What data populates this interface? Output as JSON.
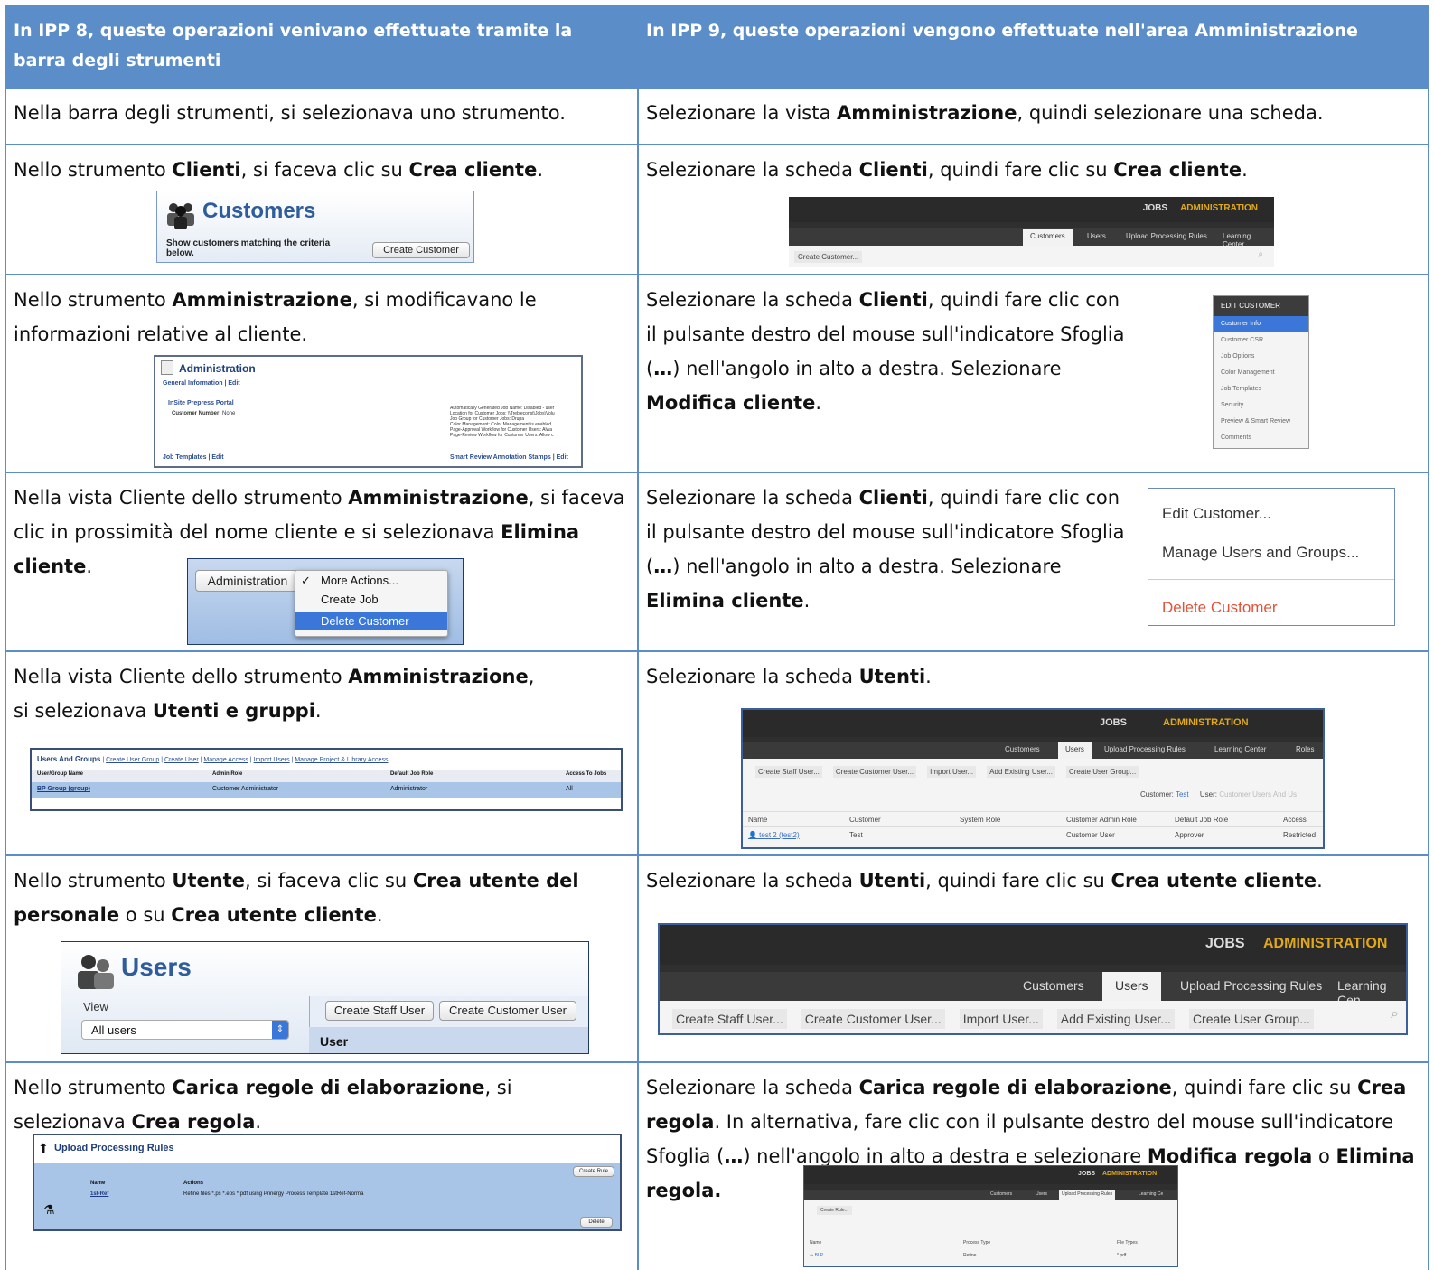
{
  "header": {
    "left": "In IPP 8, queste operazioni venivano effettuate tramite la barra degli strumenti",
    "right": "In IPP 9, queste operazioni vengono effettuate nell'area Amministrazione"
  },
  "rows": [
    {
      "left": [
        "Nella barra degli strumenti, si selezionava uno strumento."
      ],
      "right": [
        "Selezionare la vista ",
        {
          "b": "Amministrazione"
        },
        ", quindi selezionare una scheda."
      ]
    },
    {
      "left": [
        "Nello strumento ",
        {
          "b": "Clienti"
        },
        ", si faceva clic su ",
        {
          "b": "Crea cliente"
        },
        "."
      ],
      "right": [
        "Selezionare la scheda ",
        {
          "b": "Clienti"
        },
        ", quindi fare clic su ",
        {
          "b": "Crea cliente"
        },
        "."
      ]
    },
    {
      "left": [
        "Nello strumento ",
        {
          "b": "Amministrazione"
        },
        ", si modificavano le informazioni relative al cliente."
      ],
      "right": [
        "Selezionare la scheda ",
        {
          "b": "Clienti"
        },
        ", quindi fare clic con il pulsante destro del mouse sull'indicatore Sfoglia (",
        {
          "b": "…"
        },
        ") nell'angolo in alto a destra. Selezionare ",
        {
          "b": "Modifica cliente"
        },
        "."
      ]
    },
    {
      "left": [
        "Nella vista Cliente dello strumento ",
        {
          "b": "Amministrazione"
        },
        ", si faceva clic in prossimità del nome cliente e si selezionava ",
        {
          "b": "Elimina cliente"
        },
        "."
      ],
      "right": [
        "Selezionare la scheda ",
        {
          "b": "Clienti"
        },
        ", quindi fare clic con il pulsante destro del mouse sull'indicatore Sfoglia (",
        {
          "b": "…"
        },
        ") nell'angolo in alto a destra. Selezionare ",
        {
          "b": "Elimina cliente"
        },
        "."
      ]
    },
    {
      "left": [
        "Nella vista Cliente dello strumento ",
        {
          "b": "Amministrazione"
        },
        ",\nsi selezionava ",
        {
          "b": "Utenti e gruppi"
        },
        "."
      ],
      "right": [
        "Selezionare la scheda ",
        {
          "b": "Utenti"
        },
        "."
      ]
    },
    {
      "left": [
        "Nello strumento ",
        {
          "b": "Utente"
        },
        ", si faceva clic su ",
        {
          "b": "Crea utente del personale"
        },
        " o su ",
        {
          "b": "Crea utente cliente"
        },
        "."
      ],
      "right": [
        "Selezionare la scheda ",
        {
          "b": "Utenti"
        },
        ", quindi fare clic su ",
        {
          "b": "Crea utente cliente"
        },
        "."
      ]
    },
    {
      "left": [
        "Nello strumento ",
        {
          "b": "Carica regole di elaborazione"
        },
        ", si selezionava ",
        {
          "b": "Crea regola"
        },
        "."
      ],
      "right": [
        "Selezionare la scheda ",
        {
          "b": "Carica regole di elaborazione"
        },
        ", quindi fare clic su ",
        {
          "b": "Crea regola"
        },
        ". In alternativa, fare clic con il pulsante destro del mouse sull'indicatore Sfoglia (",
        {
          "b": "…"
        },
        ") nell'angolo in alto a destra e selezionare ",
        {
          "b": "Modifica regola"
        },
        " o ",
        {
          "b": "Elimina regola."
        }
      ]
    }
  ],
  "shots": {
    "customers_old": {
      "title": "Customers",
      "note": "Show customers matching the criteria below.",
      "button": "Create Customer"
    },
    "nav": {
      "jobs": "JOBS",
      "admin": "ADMINISTRATION",
      "tabs": [
        "Customers",
        "Users",
        "Upload Processing Rules",
        "Learning Center",
        "Roles"
      ],
      "create_customer": "Create Customer..."
    },
    "admin_old": {
      "title": "Administration",
      "general": "General Information",
      "edit": "Edit",
      "portal": "InSite Prepress Portal",
      "cust_number_label": "Customer Number:",
      "cust_number_value": "None",
      "settings": [
        "Automatically Generated Job Name:  Disabled - user",
        "Location for Customer Jobs:  \\\\Trebleconst\\Jobs\\Volu",
        "Job Group for Customer Jobs:  Drupa",
        "Color Management:  Color Management is enabled",
        "Page-Approval Workflow for Customer Users:  Alwa",
        "Page-Review Workflow for Customer Users:  Allow c"
      ],
      "job_templates": "Job Templates",
      "smart_review": "Smart Review Annotation Stamps"
    },
    "edit_customer_menu": {
      "title": "EDIT CUSTOMER",
      "items": [
        "Customer Info",
        "Customer CSR",
        "Job Options",
        "Color Management",
        "Job Templates",
        "Security",
        "Preview & Smart Review",
        "Comments"
      ]
    },
    "more_actions": {
      "label": "Administration",
      "check": "✓",
      "items": [
        "More Actions...",
        "Create Job",
        "Delete Customer"
      ]
    },
    "context_menu": {
      "items": [
        "Edit Customer...",
        "Manage Users and Groups...",
        "Delete Customer"
      ]
    },
    "users_groups_old": {
      "links": [
        "Users And Groups",
        "Create User Group",
        "Create User",
        "Manage Access",
        "Import Users",
        "Manage Project & Library Access"
      ],
      "columns": [
        "User/Group Name",
        "Admin Role",
        "Default Job Role",
        "Access To Jobs"
      ],
      "row": [
        "BP Group (group)",
        "Customer Administrator",
        "Administrator",
        "All"
      ]
    },
    "users_new": {
      "buttons": [
        "Create Staff User...",
        "Create Customer User...",
        "Import User...",
        "Add Existing User...",
        "Create User Group..."
      ],
      "customer_label": "Customer:",
      "customer_value": "Test",
      "user_label": "User:",
      "user_placeholder": "Customer Users And Us",
      "columns": [
        "Name",
        "Customer",
        "System Role",
        "Customer Admin Role",
        "Default Job Role",
        "Access"
      ],
      "row": [
        "test 2 (test2)",
        "Test",
        "",
        "Customer User",
        "Approver",
        "Restricted"
      ]
    },
    "users_old": {
      "title": "Users",
      "view_label": "View",
      "view_value": "All users",
      "buttons": [
        "Create Staff User",
        "Create Customer User"
      ],
      "header": "User"
    },
    "users_new_big": {
      "jobs": "JOBS",
      "admin": "ADMINISTRATION",
      "tabs": [
        "Customers",
        "Users",
        "Upload Processing Rules",
        "Learning Cen"
      ],
      "buttons": [
        "Create Staff User...",
        "Create Customer User...",
        "Import User...",
        "Add Existing User...",
        "Create User Group..."
      ]
    },
    "upr_old": {
      "title": "Upload Processing Rules",
      "button": "Create Rule",
      "columns": [
        "Name",
        "Actions"
      ],
      "row_name": "1st-Ref",
      "row_action": "Refine files *.ps *.eps *.pdf using Prinergy Process Template 1stRef-Norma",
      "delete": "Delete"
    },
    "upr_new": {
      "jobs": "JOBS",
      "admin": "ADMINISTRATION",
      "tabs": [
        "Customers",
        "Users",
        "Upload Processing Rules",
        "Learning Ce"
      ],
      "button": "Create Rule...",
      "columns": [
        "Name",
        "Process Type",
        "File Types"
      ],
      "row": [
        "BLP",
        "Refine",
        "*.pdf"
      ]
    }
  },
  "colors": {
    "header_bg": "#5b8dc8",
    "border": "#5b8dc8",
    "admin_gold": "#e0a81c",
    "delete_red": "#e0533a",
    "menu_blue": "#3b77d8"
  }
}
